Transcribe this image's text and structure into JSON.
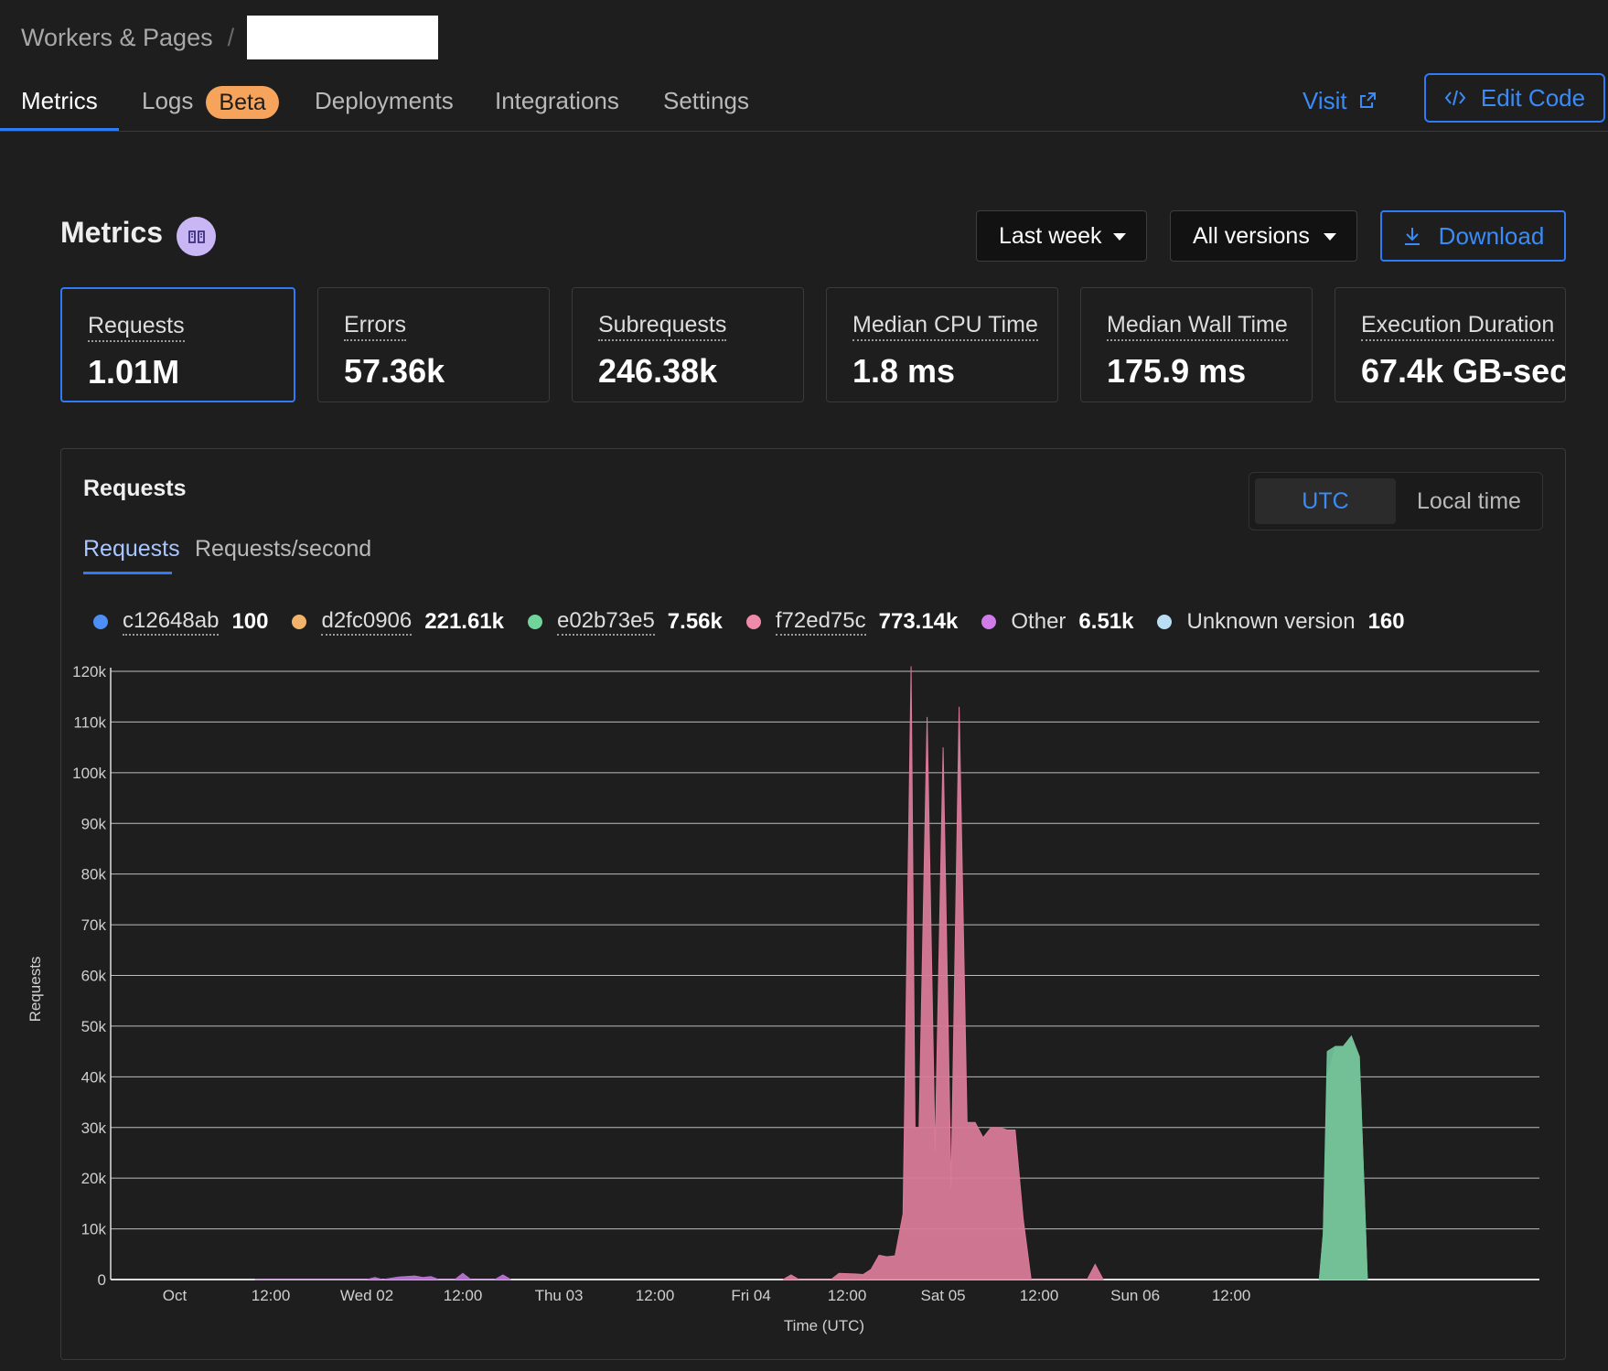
{
  "breadcrumb": {
    "root": "Workers & Pages",
    "separator": "/"
  },
  "tabs": [
    {
      "label": "Metrics",
      "active": true
    },
    {
      "label": "Logs",
      "badge": "Beta"
    },
    {
      "label": "Deployments"
    },
    {
      "label": "Integrations"
    },
    {
      "label": "Settings"
    }
  ],
  "actions": {
    "visit": "Visit",
    "edit_code": "Edit Code"
  },
  "metrics_header": {
    "title": "Metrics",
    "range": "Last week",
    "versions": "All versions",
    "download": "Download"
  },
  "cards": [
    {
      "label": "Requests",
      "value": "1.01M",
      "selected": true
    },
    {
      "label": "Errors",
      "value": "57.36k"
    },
    {
      "label": "Subrequests",
      "value": "246.38k"
    },
    {
      "label": "Median CPU Time",
      "value": "1.8 ms"
    },
    {
      "label": "Median Wall Time",
      "value": "175.9 ms"
    },
    {
      "label": "Execution Duration",
      "value": "67.4k GB-sec"
    }
  ],
  "panel": {
    "title": "Requests",
    "tz_utc": "UTC",
    "tz_local": "Local time",
    "subtab_requests": "Requests",
    "subtab_rps": "Requests/second"
  },
  "legend": [
    {
      "name": "c12648ab",
      "value": "100",
      "color": "#4b8ff7",
      "dotted": true
    },
    {
      "name": "d2fc0906",
      "value": "221.61k",
      "color": "#f2b36a",
      "dotted": true
    },
    {
      "name": "e02b73e5",
      "value": "7.56k",
      "color": "#6fd59a",
      "dotted": true
    },
    {
      "name": "f72ed75c",
      "value": "773.14k",
      "color": "#f08aa9",
      "dotted": true
    },
    {
      "name": "Other",
      "value": "6.51k",
      "color": "#cf7be8",
      "dotted": false
    },
    {
      "name": "Unknown version",
      "value": "160",
      "color": "#b9def4",
      "dotted": false
    }
  ],
  "chart_data": {
    "type": "area",
    "ylabel": "Requests",
    "xlabel": "Time (UTC)",
    "ylim": [
      0,
      120000
    ],
    "y_ticks": [
      0,
      10000,
      20000,
      30000,
      40000,
      50000,
      60000,
      70000,
      80000,
      90000,
      100000,
      110000,
      120000
    ],
    "y_tick_labels": [
      "0",
      "10k",
      "20k",
      "30k",
      "40k",
      "50k",
      "60k",
      "70k",
      "80k",
      "90k",
      "100k",
      "110k",
      "120k"
    ],
    "x_range_hours": [
      -8,
      170.5
    ],
    "x_ticks": [
      0,
      12,
      24,
      36,
      48,
      60,
      72,
      84,
      96,
      108,
      120,
      132,
      144,
      156
    ],
    "x_tick_labels": [
      "Oct",
      "12:00",
      "Wed 02",
      "12:00",
      "Thu 03",
      "12:00",
      "Fri 04",
      "12:00",
      "Sat 05",
      "12:00",
      "Sun 06",
      "12:00"
    ],
    "x_tick_label_hours": [
      0,
      12,
      24,
      36,
      48,
      60,
      72,
      84,
      96,
      108,
      120,
      132
    ],
    "grid": true,
    "series": [
      {
        "name": "f72ed75c",
        "color": "#d87a98",
        "points": [
          [
            76,
            0
          ],
          [
            77,
            900
          ],
          [
            78,
            0
          ],
          [
            82,
            0
          ],
          [
            83,
            1200
          ],
          [
            85,
            1100
          ],
          [
            86,
            1000
          ],
          [
            87,
            2000
          ],
          [
            88,
            4800
          ],
          [
            89,
            4500
          ],
          [
            90,
            4700
          ],
          [
            91,
            13000
          ],
          [
            92,
            121000
          ],
          [
            92.5,
            30000
          ],
          [
            93,
            30000
          ],
          [
            94,
            111000
          ],
          [
            95,
            25000
          ],
          [
            96,
            105000
          ],
          [
            97,
            18000
          ],
          [
            98,
            113000
          ],
          [
            99,
            31000
          ],
          [
            100,
            31000
          ],
          [
            101,
            28000
          ],
          [
            102,
            30000
          ],
          [
            103,
            30000
          ],
          [
            104,
            29500
          ],
          [
            105,
            29500
          ],
          [
            106,
            12000
          ],
          [
            107,
            0
          ],
          [
            114,
            0
          ],
          [
            115,
            3000
          ],
          [
            116,
            0
          ]
        ]
      },
      {
        "name": "d2fc0906",
        "color": "#c59a5e",
        "points": [
          [
            143,
            0
          ],
          [
            143.5,
            9000
          ],
          [
            144,
            40000
          ],
          [
            145,
            46000
          ],
          [
            146,
            46000
          ],
          [
            147,
            48000
          ],
          [
            148,
            44000
          ],
          [
            149,
            0
          ]
        ]
      },
      {
        "name": "e02b73e5",
        "color": "#6fc19a",
        "points": [
          [
            143,
            0
          ],
          [
            143.5,
            9000
          ],
          [
            144,
            45000
          ],
          [
            145,
            46000
          ],
          [
            146,
            46000
          ],
          [
            147,
            48000
          ],
          [
            148,
            44000
          ],
          [
            149,
            0
          ]
        ]
      },
      {
        "name": "Other",
        "color": "#b774d0",
        "points": [
          [
            10,
            0
          ],
          [
            24,
            0
          ],
          [
            25,
            400
          ],
          [
            26,
            0
          ],
          [
            28,
            500
          ],
          [
            30,
            700
          ],
          [
            31,
            400
          ],
          [
            32,
            600
          ],
          [
            33,
            0
          ],
          [
            35,
            0
          ],
          [
            36,
            1200
          ],
          [
            37,
            0
          ],
          [
            40,
            0
          ],
          [
            41,
            900
          ],
          [
            42,
            0
          ]
        ]
      }
    ]
  }
}
